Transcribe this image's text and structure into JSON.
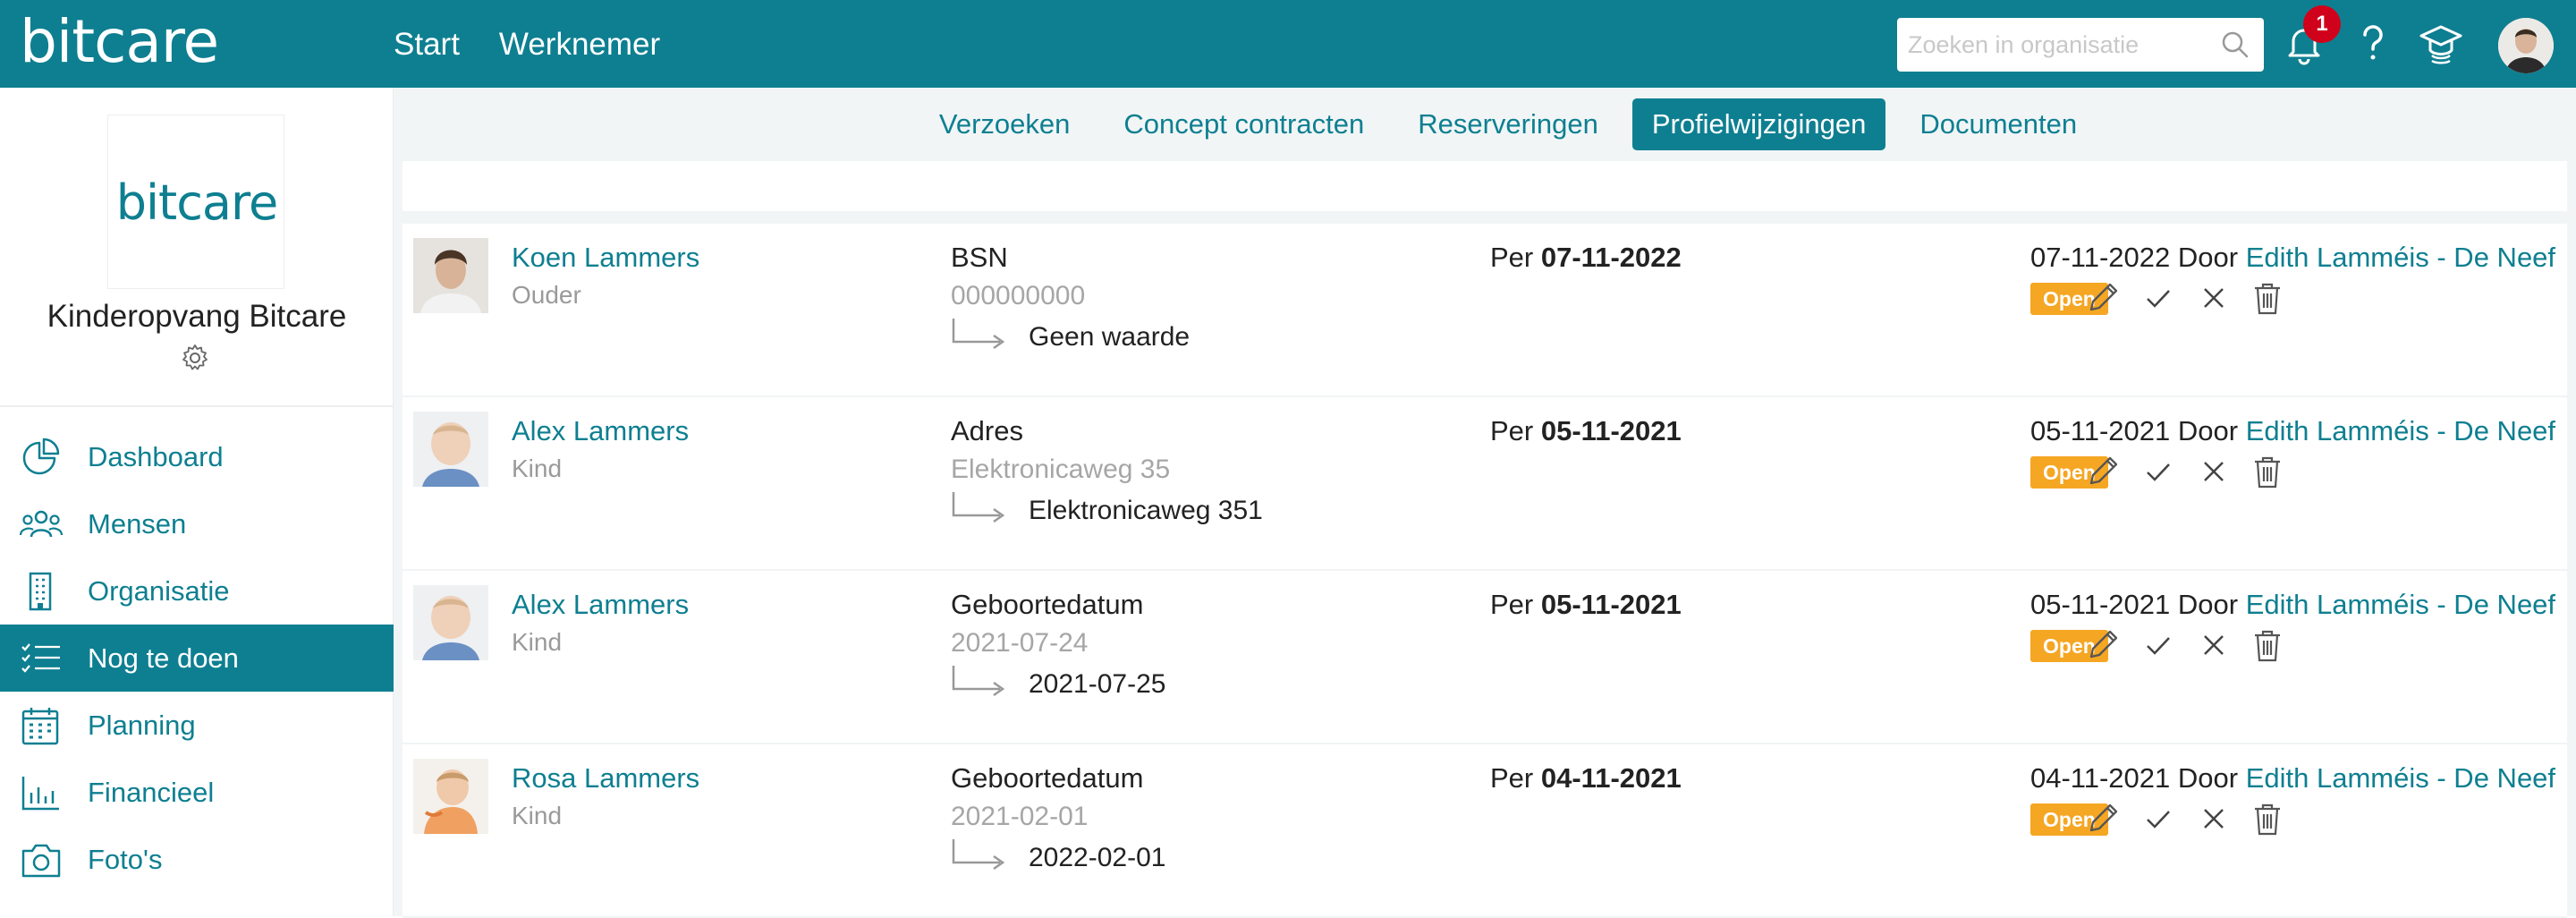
{
  "app": {
    "logo": "bitcare"
  },
  "topnav": {
    "start": "Start",
    "werknemer": "Werknemer"
  },
  "search": {
    "placeholder": "Zoeken in organisatie"
  },
  "notifications": {
    "count": "1"
  },
  "sidebar": {
    "org_logo": "bitcare",
    "org_name": "Kinderopvang Bitcare",
    "items": [
      {
        "label": "Dashboard",
        "icon": "pie-chart-icon"
      },
      {
        "label": "Mensen",
        "icon": "people-icon"
      },
      {
        "label": "Organisatie",
        "icon": "building-icon"
      },
      {
        "label": "Nog te doen",
        "icon": "checklist-icon",
        "active": true
      },
      {
        "label": "Planning",
        "icon": "calendar-icon"
      },
      {
        "label": "Financieel",
        "icon": "bar-chart-icon"
      },
      {
        "label": "Foto's",
        "icon": "camera-icon"
      }
    ]
  },
  "tabs": [
    {
      "label": "Verzoeken"
    },
    {
      "label": "Concept contracten"
    },
    {
      "label": "Reserveringen"
    },
    {
      "label": "Profielwijzigingen",
      "active": true
    },
    {
      "label": "Documenten"
    }
  ],
  "rows": [
    {
      "name": "Koen Lammers",
      "role": "Ouder",
      "field": "BSN",
      "old": "000000000",
      "new": "Geen waarde",
      "per_label": "Per",
      "per_date": "07-11-2022",
      "date": "07-11-2022",
      "door": "Door",
      "by": "Edith Lamméis - De Neef",
      "status": "Open"
    },
    {
      "name": "Alex Lammers",
      "role": "Kind",
      "field": "Adres",
      "old": "Elektronicaweg 35",
      "new": "Elektronicaweg 351",
      "per_label": "Per",
      "per_date": "05-11-2021",
      "date": "05-11-2021",
      "door": "Door",
      "by": "Edith Lamméis - De Neef",
      "status": "Open"
    },
    {
      "name": "Alex Lammers",
      "role": "Kind",
      "field": "Geboortedatum",
      "old": "2021-07-24",
      "new": "2021-07-25",
      "per_label": "Per",
      "per_date": "05-11-2021",
      "date": "05-11-2021",
      "door": "Door",
      "by": "Edith Lamméis - De Neef",
      "status": "Open"
    },
    {
      "name": "Rosa Lammers",
      "role": "Kind",
      "field": "Geboortedatum",
      "old": "2021-02-01",
      "new": "2022-02-01",
      "per_label": "Per",
      "per_date": "04-11-2021",
      "date": "04-11-2021",
      "door": "Door",
      "by": "Edith Lamméis - De Neef",
      "status": "Open"
    }
  ],
  "colors": {
    "brand": "#0e7f91",
    "status_open": "#f5a623",
    "badge": "#d0021b"
  }
}
